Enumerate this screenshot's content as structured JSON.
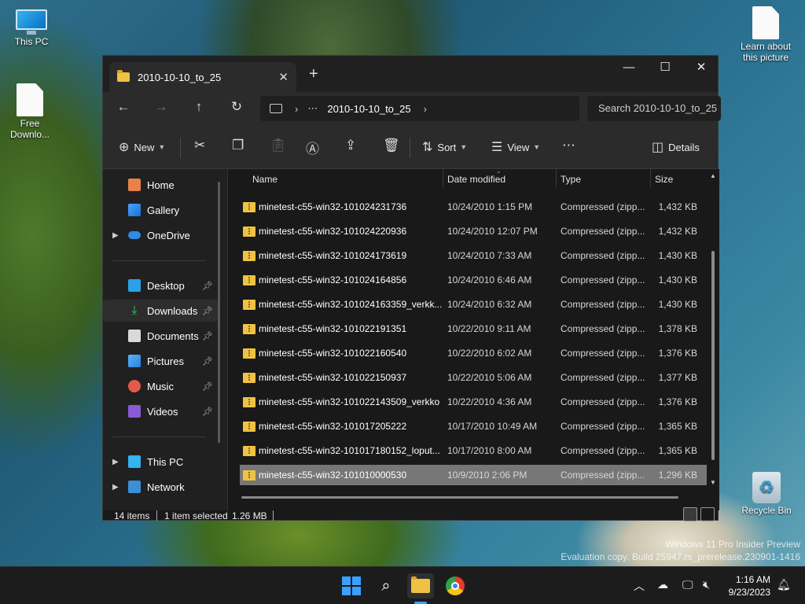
{
  "desktop": {
    "icons": {
      "this_pc": "This PC",
      "free_download": "Free Downlo...",
      "learn_picture": "Learn about this picture",
      "recycle_bin": "Recycle Bin"
    },
    "watermark_line1": "Windows 11 Pro Insider Preview",
    "watermark_line2": "Evaluation copy. Build 25947.rs_prerelease.230901-1416"
  },
  "window": {
    "tab_title": "2010-10-10_to_25",
    "breadcrumb": "2010-10-10_to_25",
    "search_placeholder": "Search 2010-10-10_to_25"
  },
  "commandbar": {
    "new_label": "New",
    "sort_label": "Sort",
    "view_label": "View",
    "details_label": "Details"
  },
  "nav": {
    "home": "Home",
    "gallery": "Gallery",
    "onedrive": "OneDrive",
    "desktop": "Desktop",
    "downloads": "Downloads",
    "documents": "Documents",
    "pictures": "Pictures",
    "music": "Music",
    "videos": "Videos",
    "this_pc": "This PC",
    "network": "Network"
  },
  "columns": {
    "name": "Name",
    "date": "Date modified",
    "type": "Type",
    "size": "Size"
  },
  "files": [
    {
      "name": "minetest-c55-win32-101024231736",
      "date": "10/24/2010 1:15 PM",
      "type": "Compressed (zipp...",
      "size": "1,432 KB"
    },
    {
      "name": "minetest-c55-win32-101024220936",
      "date": "10/24/2010 12:07 PM",
      "type": "Compressed (zipp...",
      "size": "1,432 KB"
    },
    {
      "name": "minetest-c55-win32-101024173619",
      "date": "10/24/2010 7:33 AM",
      "type": "Compressed (zipp...",
      "size": "1,430 KB"
    },
    {
      "name": "minetest-c55-win32-101024164856",
      "date": "10/24/2010 6:46 AM",
      "type": "Compressed (zipp...",
      "size": "1,430 KB"
    },
    {
      "name": "minetest-c55-win32-101024163359_verkk...",
      "date": "10/24/2010 6:32 AM",
      "type": "Compressed (zipp...",
      "size": "1,430 KB"
    },
    {
      "name": "minetest-c55-win32-101022191351",
      "date": "10/22/2010 9:11 AM",
      "type": "Compressed (zipp...",
      "size": "1,378 KB"
    },
    {
      "name": "minetest-c55-win32-101022160540",
      "date": "10/22/2010 6:02 AM",
      "type": "Compressed (zipp...",
      "size": "1,376 KB"
    },
    {
      "name": "minetest-c55-win32-101022150937",
      "date": "10/22/2010 5:06 AM",
      "type": "Compressed (zipp...",
      "size": "1,377 KB"
    },
    {
      "name": "minetest-c55-win32-101022143509_verkko",
      "date": "10/22/2010 4:36 AM",
      "type": "Compressed (zipp...",
      "size": "1,376 KB"
    },
    {
      "name": "minetest-c55-win32-101017205222",
      "date": "10/17/2010 10:49 AM",
      "type": "Compressed (zipp...",
      "size": "1,365 KB"
    },
    {
      "name": "minetest-c55-win32-101017180152_loput...",
      "date": "10/17/2010 8:00 AM",
      "type": "Compressed (zipp...",
      "size": "1,365 KB"
    },
    {
      "name": "minetest-c55-win32-101010000530",
      "date": "10/9/2010 2:06 PM",
      "type": "Compressed (zipp...",
      "size": "1,296 KB",
      "selected": true
    }
  ],
  "status": {
    "items": "14 items",
    "selected": "1 item selected",
    "size": "1.26 MB"
  },
  "taskbar": {
    "time": "1:16 AM",
    "date": "9/23/2023"
  },
  "colors": {
    "accent": "#3aa0ff",
    "folder": "#f0c243",
    "selected_row": "#777777"
  }
}
